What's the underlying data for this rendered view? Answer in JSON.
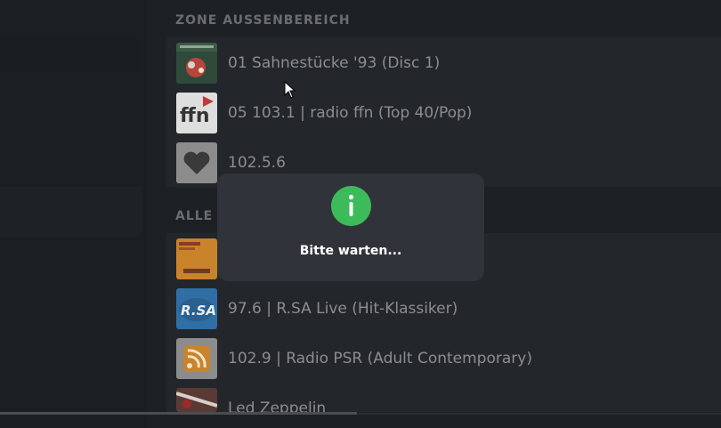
{
  "zone_section": {
    "title": "ZONE AUSSENBEREICH"
  },
  "all_section": {
    "title_visible": "ALLE I"
  },
  "zone_items": [
    {
      "label": "01 Sahnestücke '93 (Disc 1)",
      "icon": "album-cover-icon"
    },
    {
      "label": "05 103.1 | radio ffn (Top 40/Pop)",
      "icon": "ffn-logo-icon"
    },
    {
      "label": "102.5.6",
      "icon": "heart-icon"
    }
  ],
  "all_items": [
    {
      "label": "",
      "icon": "podcast-cover-icon"
    },
    {
      "label": "97.6 | R.SA Live (Hit-Klassiker)",
      "icon": "rsa-logo-icon"
    },
    {
      "label": "102.9 | Radio PSR (Adult Contemporary)",
      "icon": "rss-icon"
    },
    {
      "label": "Led Zeppelin",
      "icon": "album-cover-icon"
    }
  ],
  "modal": {
    "message": "Bitte warten...",
    "icon": "info-icon",
    "accent": "#3dbb5b"
  },
  "colors": {
    "background": "#1d2024",
    "panel": "#23262a",
    "modal": "#30343a"
  }
}
